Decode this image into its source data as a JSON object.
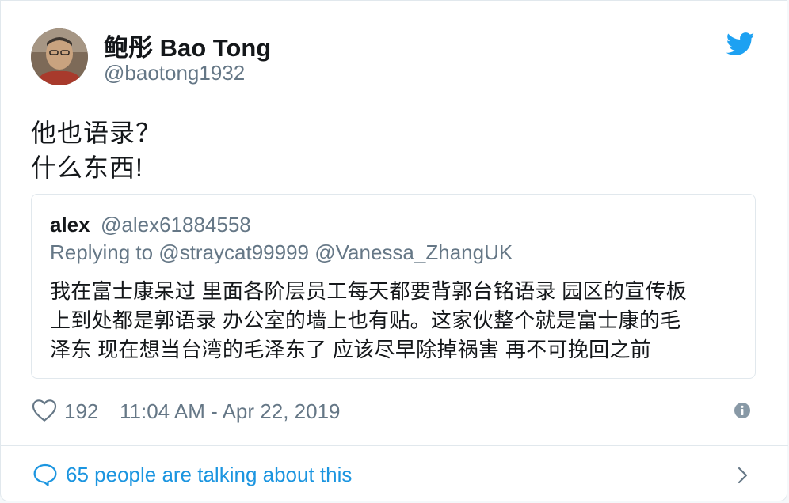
{
  "author": {
    "display_name": "鲍彤 Bao Tong",
    "handle": "@baotong1932"
  },
  "tweet": {
    "lines": [
      "他也语录？",
      "什么东西!"
    ]
  },
  "quoted_tweet": {
    "name": "alex",
    "handle": "@alex61884558",
    "replying_to": "Replying to @straycat99999 @Vanessa_ZhangUK",
    "lines": [
      "我在富士康呆过 里面各阶层员工每天都要背郭台铭语录 园区的宣传板",
      "上到处都是郭语录 办公室的墙上也有贴。这家伙整个就是富士康的毛",
      "泽东 现在想当台湾的毛泽东了 应该尽早除掉祸害 再不可挽回之前"
    ]
  },
  "footer": {
    "likes": "192",
    "timestamp": "11:04 AM - Apr 22, 2019"
  },
  "conversation": {
    "label": "65 people are talking about this"
  },
  "icons": {
    "brand": "twitter-bird-icon",
    "like": "heart-icon",
    "info": "info-icon",
    "reply": "speech-bubble-icon",
    "more": "chevron-right-icon"
  },
  "colors": {
    "brand_blue": "#1da1f2",
    "link_blue": "#1b95e0",
    "secondary_text": "#657786",
    "border": "#e1e8ed"
  }
}
